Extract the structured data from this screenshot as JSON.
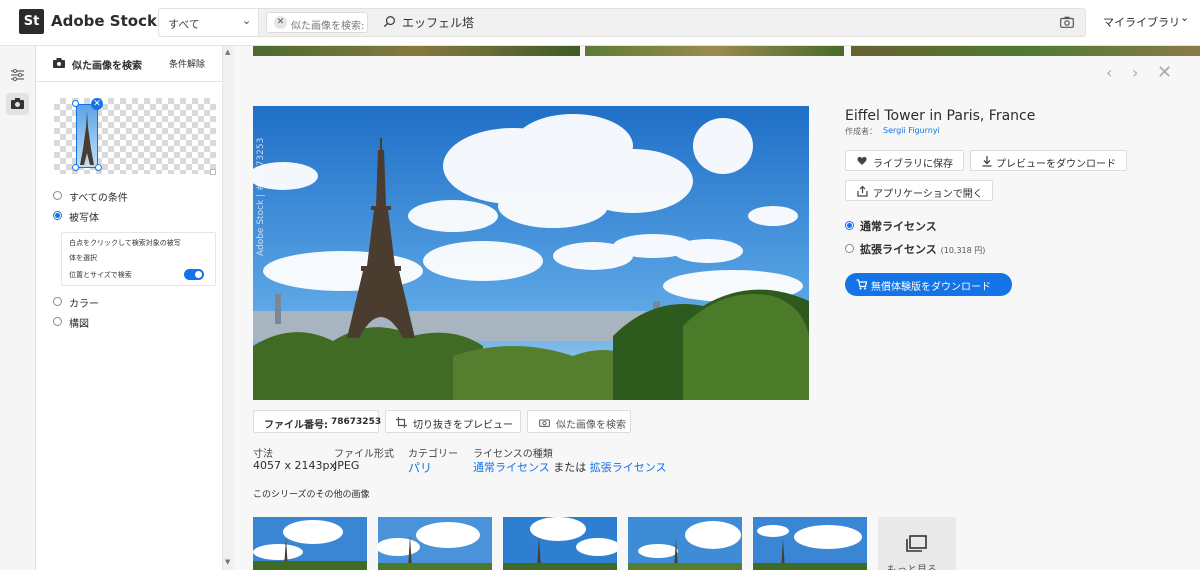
{
  "header": {
    "logo_text": "St",
    "brand": "Adobe Stock",
    "scope": "すべて",
    "similar_chip": "似た画像を検索:",
    "search_value": "エッフェル塔",
    "my_library": "マイライブラリ"
  },
  "panel": {
    "title": "似た画像を検索",
    "clear": "条件解除",
    "options": [
      "すべての条件",
      "被写体",
      "カラー",
      "構図"
    ],
    "selected_option": "被写体",
    "sub_text1": "白点をクリックして検索対象の被写",
    "sub_text2": "体を選択",
    "sub_text3": "位置とサイズで検索",
    "toggle_on": true
  },
  "detail": {
    "title": "Eiffel Tower in Paris, France",
    "author_label": "作成者：",
    "author": "Sergii Figurnyi",
    "save_to_library": "ライブラリに保存",
    "download_preview": "プレビューをダウンロード",
    "open_in_app": "アプリケーションで開く",
    "license_standard": "通常ライセンス",
    "license_extended": "拡張ライセンス",
    "license_extended_price": "(10,318 円)",
    "selected_license": "通常ライセンス",
    "free_trial": "無償体験版をダウンロード",
    "watermark": "Adobe Stock | #78673253"
  },
  "info_bar": {
    "file_no_label": "ファイル番号:",
    "file_no": "78673253",
    "crop_preview": "切り抜きをプレビュー",
    "find_similar": "似た画像を検索"
  },
  "meta": {
    "size_label": "寸法",
    "size_value": "4057 x 2143px",
    "format_label": "ファイル形式",
    "format_value": "JPEG",
    "category_label": "カテゴリー",
    "category_value": "パリ",
    "license_label": "ライセンスの種類",
    "license_standard": "通常ライセンス",
    "license_or": "または",
    "license_extended": "拡張ライセンス"
  },
  "series": {
    "title": "このシリーズのその他の画像",
    "more": "もっと見る"
  },
  "colors": {
    "accent": "#1473e6",
    "text": "#2c2c2c",
    "sky": "#3d8fd9"
  }
}
